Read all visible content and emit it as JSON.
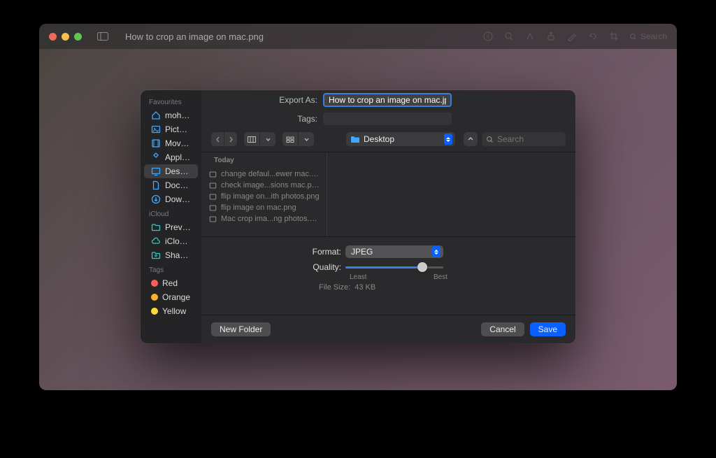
{
  "bg_window": {
    "title": "How to crop an image on mac.png",
    "search_placeholder": "Search"
  },
  "dialog": {
    "export_as_label": "Export As:",
    "export_as_value": "How to crop an image on mac.jpg",
    "tags_label": "Tags:",
    "location": "Desktop",
    "search_placeholder": "Search",
    "file_list": {
      "header": "Today",
      "items": [
        "change defaul...ewer mac.png",
        "check image...sions mac.png",
        "flip image on...ith photos.png",
        "flip image on mac.png",
        "Mac crop ima...ng photos.png"
      ]
    },
    "format_label": "Format:",
    "format_value": "JPEG",
    "quality_label": "Quality:",
    "quality_least": "Least",
    "quality_best": "Best",
    "file_size_label": "File Size:",
    "file_size_value": "43 KB",
    "new_folder": "New Folder",
    "cancel": "Cancel",
    "save": "Save"
  },
  "sidebar": {
    "favourites_title": "Favourites",
    "favourites": [
      {
        "label": "mohamm...",
        "icon": "home",
        "color": "#3ea7ff"
      },
      {
        "label": "Pictures",
        "icon": "image",
        "color": "#3ea7ff"
      },
      {
        "label": "Movies",
        "icon": "film",
        "color": "#3ea7ff"
      },
      {
        "label": "Applicati...",
        "icon": "app",
        "color": "#3ea7ff"
      },
      {
        "label": "Desktop",
        "icon": "desktop",
        "color": "#3ea7ff",
        "selected": true
      },
      {
        "label": "Documents",
        "icon": "doc",
        "color": "#3ea7ff"
      },
      {
        "label": "Downloads",
        "icon": "download",
        "color": "#3ea7ff"
      }
    ],
    "icloud_title": "iCloud",
    "icloud": [
      {
        "label": "Preview",
        "icon": "folder",
        "color": "#35c7c0"
      },
      {
        "label": "iCloud Dri...",
        "icon": "cloud",
        "color": "#35c7c0"
      },
      {
        "label": "Shared",
        "icon": "shared",
        "color": "#35c7c0"
      }
    ],
    "tags_title": "Tags",
    "tags": [
      {
        "label": "Red",
        "color": "#ff5f57"
      },
      {
        "label": "Orange",
        "color": "#fbb12d"
      },
      {
        "label": "Yellow",
        "color": "#ffd83b"
      }
    ]
  }
}
